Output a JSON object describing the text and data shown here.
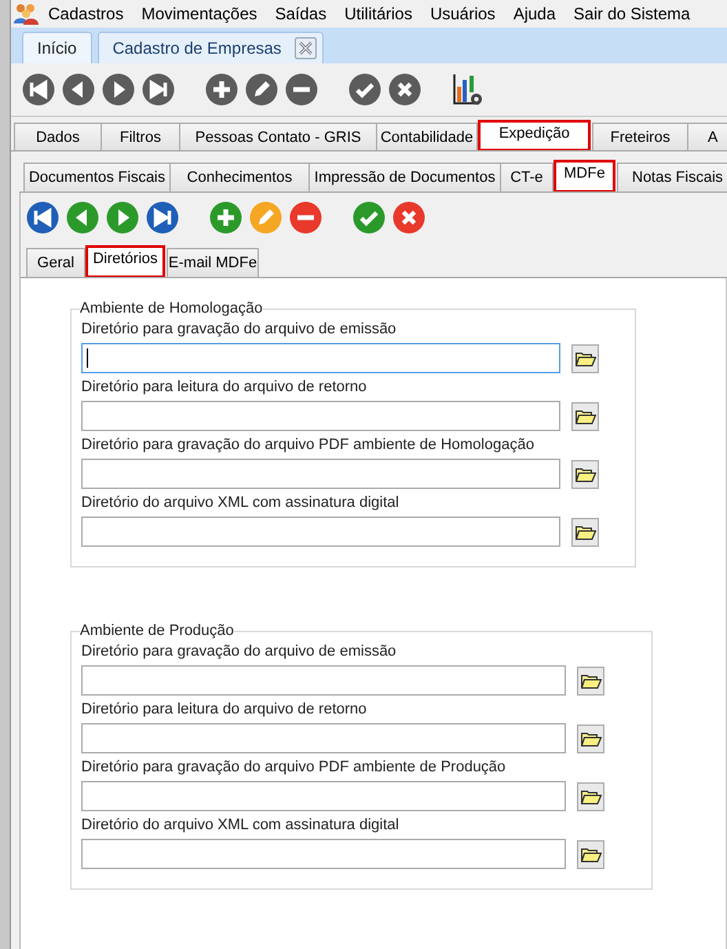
{
  "menu": [
    {
      "label": "Cadastros"
    },
    {
      "label": "Movimentações"
    },
    {
      "label": "Saídas"
    },
    {
      "label": "Utilitários"
    },
    {
      "label": "Usuários"
    },
    {
      "label": "Ajuda"
    },
    {
      "label": "Sair do Sistema"
    }
  ],
  "document_tabs": [
    {
      "label": "Início",
      "selected": false,
      "closable": false
    },
    {
      "label": "Cadastro de Empresas",
      "selected": true,
      "closable": true
    }
  ],
  "main_toolbar": {
    "disabled": true,
    "buttons": [
      {
        "kind": "first"
      },
      {
        "kind": "prev"
      },
      {
        "kind": "next"
      },
      {
        "kind": "last"
      },
      {
        "kind": "add"
      },
      {
        "kind": "edit"
      },
      {
        "kind": "remove"
      },
      {
        "kind": "confirm"
      },
      {
        "kind": "cancel"
      },
      {
        "kind": "report"
      }
    ]
  },
  "section_tabs": [
    {
      "label": "Dados",
      "selected": false
    },
    {
      "label": "Filtros",
      "selected": false
    },
    {
      "label": "Pessoas Contato - GRIS",
      "selected": false
    },
    {
      "label": "Contabilidade",
      "selected": false
    },
    {
      "label": "Expedição",
      "selected": true
    },
    {
      "label": "Freteiros",
      "selected": false
    },
    {
      "label": "A",
      "selected": false
    }
  ],
  "expedition_tabs": [
    {
      "label": "Documentos Fiscais",
      "selected": false
    },
    {
      "label": "Conhecimentos",
      "selected": false
    },
    {
      "label": "Impressão de Documentos",
      "selected": false
    },
    {
      "label": "CT-e",
      "selected": false
    },
    {
      "label": "MDFe",
      "selected": true
    },
    {
      "label": "Notas Fiscais",
      "selected": false
    }
  ],
  "mdfe_toolbar": {
    "disabled": false,
    "buttons": [
      {
        "kind": "first"
      },
      {
        "kind": "prev"
      },
      {
        "kind": "next"
      },
      {
        "kind": "last"
      },
      {
        "kind": "add"
      },
      {
        "kind": "edit"
      },
      {
        "kind": "remove"
      },
      {
        "kind": "confirm"
      },
      {
        "kind": "cancel"
      }
    ]
  },
  "mdfe_tabs": [
    {
      "label": "Geral",
      "selected": false
    },
    {
      "label": "Diretórios",
      "selected": true
    },
    {
      "label": "E-mail MDFe",
      "selected": false
    }
  ],
  "groups": [
    {
      "title": "Ambiente de Homologação",
      "fields": [
        {
          "label": "Diretório para gravação do arquivo de emissão",
          "focused": true
        },
        {
          "label": "Diretório para leitura do arquivo de retorno",
          "focused": false
        },
        {
          "label": "Diretório para gravação do arquivo PDF ambiente de Homologação",
          "focused": false
        },
        {
          "label": "Diretório do arquivo XML com assinatura digital",
          "focused": false
        }
      ]
    },
    {
      "title": "Ambiente de Produção",
      "fields": [
        {
          "label": "Diretório para gravação do arquivo de emissão",
          "focused": false
        },
        {
          "label": "Diretório para leitura do arquivo de retorno",
          "focused": false
        },
        {
          "label": "Diretório para gravação do arquivo PDF ambiente de Produção",
          "focused": false
        },
        {
          "label": "Diretório do arquivo XML com assinatura digital",
          "focused": false
        }
      ]
    }
  ]
}
